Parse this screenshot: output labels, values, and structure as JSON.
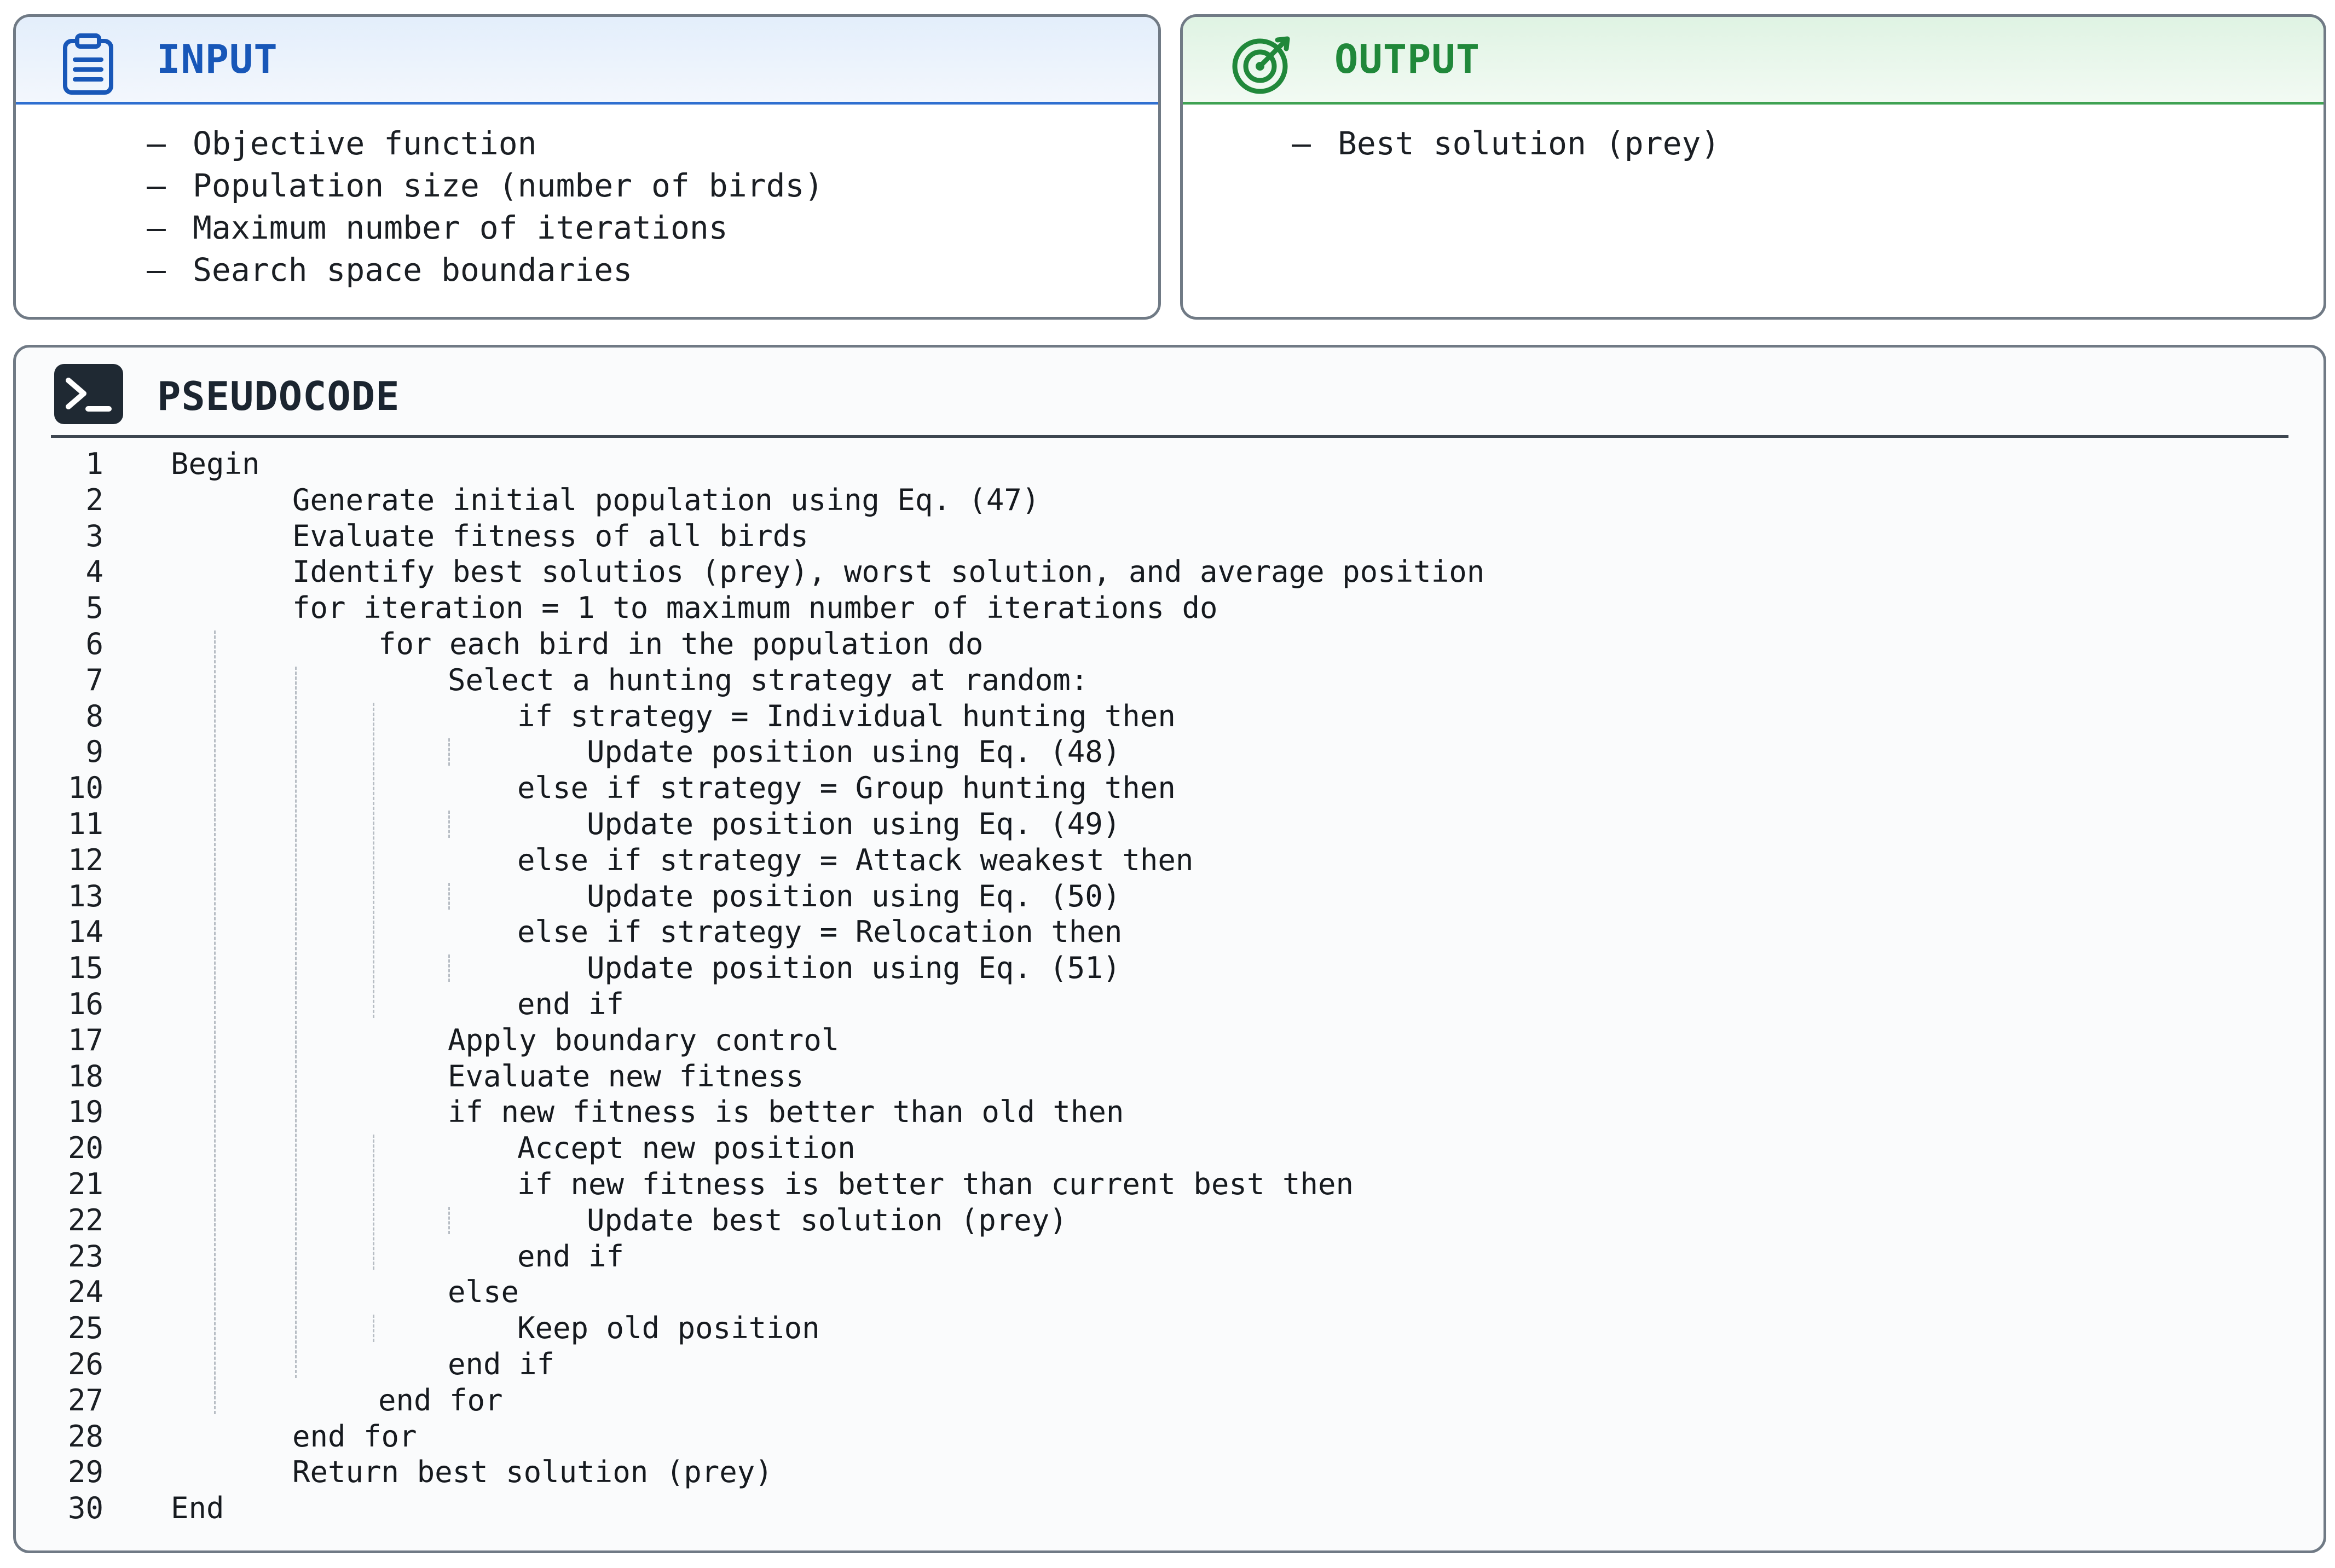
{
  "input": {
    "title": "INPUT",
    "icon": "clipboard-icon",
    "accent": "#1857b8",
    "items": [
      {
        "bullet": "–",
        "text": "Objective function"
      },
      {
        "bullet": "–",
        "text": "Population size (number of birds)"
      },
      {
        "bullet": "–",
        "text": "Maximum number of iterations"
      },
      {
        "bullet": "–",
        "text": "Search space boundaries"
      }
    ]
  },
  "output": {
    "title": "OUTPUT",
    "icon": "target-icon",
    "accent": "#20883a",
    "items": [
      {
        "bullet": "–",
        "text": "Best solution (prey)"
      }
    ]
  },
  "pseudocode": {
    "title": "PSEUDOCODE",
    "icon": "terminal-icon",
    "lines": [
      {
        "num": "1",
        "indent": 0,
        "text": "Begin"
      },
      {
        "num": "2",
        "indent": 1,
        "text": "Generate initial population using Eq. (47)"
      },
      {
        "num": "3",
        "indent": 1,
        "text": "Evaluate fitness of all birds"
      },
      {
        "num": "4",
        "indent": 1,
        "text": "Identify best solutios (prey), worst solution, and average position"
      },
      {
        "num": "5",
        "indent": 1,
        "text": "for iteration = 1 to maximum number of iterations do"
      },
      {
        "num": "6",
        "indent": 2,
        "text": "for each bird in the population do"
      },
      {
        "num": "7",
        "indent": 3,
        "text": "Select a hunting strategy at random:"
      },
      {
        "num": "8",
        "indent": 4,
        "text": "if strategy = Individual hunting then"
      },
      {
        "num": "9",
        "indent": 5,
        "text": "Update position using Eq. (48)"
      },
      {
        "num": "10",
        "indent": 4,
        "text": "else if strategy = Group hunting then"
      },
      {
        "num": "11",
        "indent": 5,
        "text": "Update position using Eq. (49)"
      },
      {
        "num": "12",
        "indent": 4,
        "text": "else if strategy = Attack weakest then"
      },
      {
        "num": "13",
        "indent": 5,
        "text": "Update position using Eq. (50)"
      },
      {
        "num": "14",
        "indent": 4,
        "text": "else if strategy = Relocation then"
      },
      {
        "num": "15",
        "indent": 5,
        "text": "Update position using Eq. (51)"
      },
      {
        "num": "16",
        "indent": 4,
        "text": "end if"
      },
      {
        "num": "17",
        "indent": 3,
        "text": "Apply boundary control"
      },
      {
        "num": "18",
        "indent": 3,
        "text": "Evaluate new fitness"
      },
      {
        "num": "19",
        "indent": 3,
        "text": "if new fitness is better than old then"
      },
      {
        "num": "20",
        "indent": 4,
        "text": "Accept new position"
      },
      {
        "num": "21",
        "indent": 4,
        "text": "if new fitness is better than current best then"
      },
      {
        "num": "22",
        "indent": 5,
        "text": "Update best solution (prey)"
      },
      {
        "num": "23",
        "indent": 4,
        "text": "end if"
      },
      {
        "num": "24",
        "indent": 3,
        "text": "else"
      },
      {
        "num": "25",
        "indent": 4,
        "text": "Keep old position"
      },
      {
        "num": "26",
        "indent": 3,
        "text": "end if"
      },
      {
        "num": "27",
        "indent": 2,
        "text": "end for"
      },
      {
        "num": "28",
        "indent": 1,
        "text": "end for"
      },
      {
        "num": "29",
        "indent": 1,
        "text": "Return best solution (prey)"
      },
      {
        "num": "30",
        "indent": 0,
        "text": "End"
      }
    ]
  }
}
